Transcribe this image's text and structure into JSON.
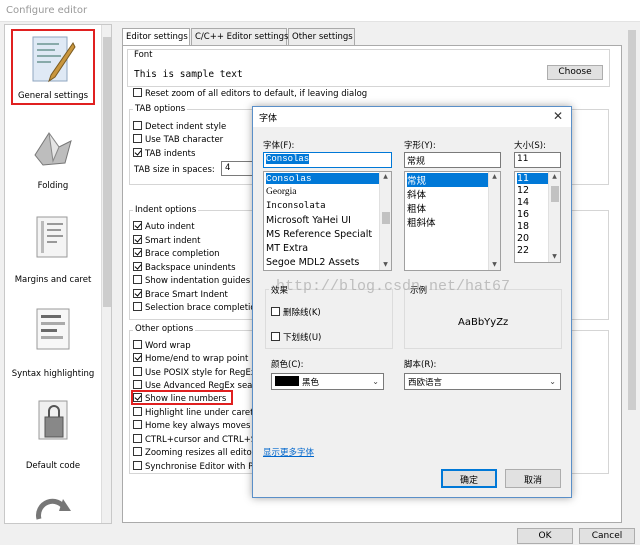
{
  "window": {
    "title": "Configure editor"
  },
  "sidebar": {
    "items": [
      {
        "label": "General settings"
      },
      {
        "label": "Folding"
      },
      {
        "label": "Margins and caret"
      },
      {
        "label": "Syntax highlighting"
      },
      {
        "label": "Default code"
      }
    ]
  },
  "tabs": [
    {
      "label": "Editor settings"
    },
    {
      "label": "C/C++ Editor settings"
    },
    {
      "label": "Other settings"
    }
  ],
  "font": {
    "group_label": "Font",
    "sample_text": "This is sample text",
    "choose_label": "Choose",
    "reset_zoom_label": "Reset zoom of all editors to default, if leaving dialog"
  },
  "tab_options": {
    "title": "TAB options",
    "detect_indent": "Detect indent style",
    "use_tab_char": "Use TAB character",
    "tab_indents": "TAB indents",
    "tab_size_label": "TAB size in spaces:",
    "tab_size_value": "4"
  },
  "indent_options": {
    "title": "Indent options",
    "auto_indent": "Auto indent",
    "smart_indent": "Smart indent",
    "brace_completion": "Brace completion",
    "backspace_unindents": "Backspace unindents",
    "show_guides": "Show indentation guides",
    "brace_smart_indent": "Brace Smart Indent",
    "selection_brace": "Selection brace completion"
  },
  "other_options": {
    "title": "Other options",
    "word_wrap": "Word wrap",
    "home_end": "Home/end to wrap point",
    "posix": "Use POSIX style for RegEx",
    "advanced_regex": "Use Advanced RegEx sear",
    "show_line_numbers": "Show line numbers",
    "highlight_line": "Highlight line under caret",
    "home_key": "Home key always moves c",
    "ctrl_cursor": "CTRL+cursor and CTRL+S",
    "zooming": "Zooming resizes all editors",
    "synchronise": "Synchronise Editor with Pr"
  },
  "footer": {
    "ok": "OK",
    "cancel": "Cancel"
  },
  "dialog": {
    "title": "字体",
    "font_label": "字体(F):",
    "font_value": "Consolas",
    "font_list": [
      "Consolas",
      "Georgia",
      "Inconsolata",
      "Microsoft YaHei UI",
      "MS Reference Specialt",
      "MT Extra",
      "Segoe MDL2 Assets"
    ],
    "style_label": "字形(Y):",
    "style_value": "常规",
    "style_list": [
      "常规",
      "斜体",
      "粗体",
      "粗斜体"
    ],
    "size_label": "大小(S):",
    "size_value": "11",
    "size_list": [
      "11",
      "12",
      "14",
      "16",
      "18",
      "20",
      "22"
    ],
    "effects_label": "效果",
    "strikeout": "删除线(K)",
    "underline": "下划线(U)",
    "color_label": "颜色(C):",
    "color_value": "黑色",
    "sample_label": "示例",
    "sample_text": "AaBbYyZz",
    "script_label": "脚本(R):",
    "script_value": "西欧语言",
    "more_fonts": "显示更多字体",
    "ok": "确定",
    "cancel": "取消"
  },
  "watermark": "http://blog.csdn.net/hat67",
  "colors": {
    "highlight_red": "#e02020",
    "selection_blue": "#0078d7",
    "link_blue": "#0066cc"
  }
}
